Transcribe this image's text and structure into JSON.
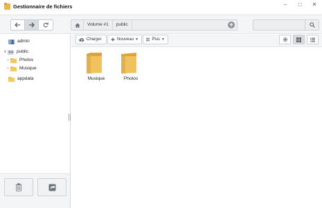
{
  "window": {
    "title": "Gestionnaire de fichiers",
    "controls": [
      "minimize",
      "maximize",
      "close"
    ]
  },
  "nav": {
    "back": "arrow-left-icon",
    "forward": "arrow-right-icon",
    "refresh": "refresh-icon"
  },
  "path": {
    "crumbs": [
      "Volume #1",
      "public"
    ]
  },
  "search": {
    "value": "",
    "placeholder": ""
  },
  "sidebar": {
    "items": [
      {
        "label": "admin",
        "icon": "user-folder-icon"
      },
      {
        "label": "public",
        "icon": "shared-folder-icon",
        "expanded": true
      },
      {
        "label": "Photos",
        "icon": "folder-icon"
      },
      {
        "label": "Musique",
        "icon": "folder-icon"
      },
      {
        "label": "appdata",
        "icon": "folder-icon"
      }
    ]
  },
  "actions": {
    "upload_label": "Charger",
    "new_label": "Nouveau",
    "more_label": "Plus"
  },
  "files": [
    {
      "name": "Musique"
    },
    {
      "name": "Photos"
    }
  ],
  "colors": {
    "folder": "#f0c25e",
    "folder_dark": "#d9a43f",
    "toolbar": "#f4f5f6"
  }
}
